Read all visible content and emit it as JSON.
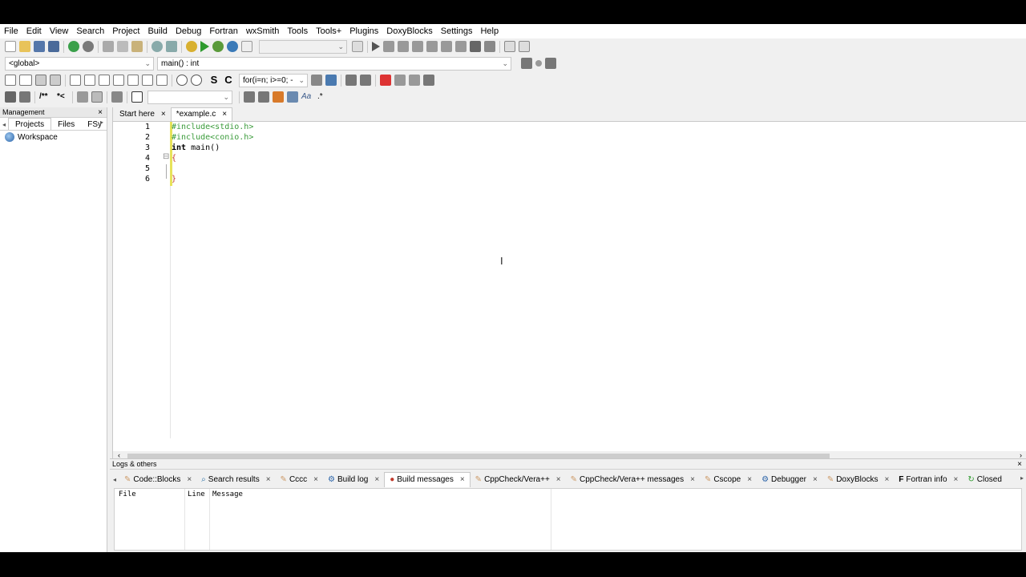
{
  "menu": [
    "File",
    "Edit",
    "View",
    "Search",
    "Project",
    "Build",
    "Debug",
    "Fortran",
    "wxSmith",
    "Tools",
    "Tools+",
    "Plugins",
    "DoxyBlocks",
    "Settings",
    "Help"
  ],
  "scope_combo": "<global>",
  "function_combo": "main() : int",
  "search_combo": "for(i=n; i>=0; -",
  "management": {
    "title": "Management",
    "close": "×",
    "tabs": [
      "Projects",
      "Files",
      "FSy"
    ],
    "workspace": "Workspace"
  },
  "editor": {
    "tabs": [
      {
        "label": "Start here",
        "close": "×"
      },
      {
        "label": "*example.c",
        "close": "×"
      }
    ],
    "line_numbers": [
      "1",
      "2",
      "3",
      "4",
      "5",
      "6"
    ],
    "lines": [
      "#include<stdio.h>",
      "#include<conio.h>",
      "main()",
      "{",
      "",
      "}"
    ],
    "keyword": "int",
    "fold_icon": "⊟"
  },
  "logs": {
    "title": "Logs & others",
    "close": "×",
    "tabs": [
      "Code::Blocks",
      "Search results",
      "Cccc",
      "Build log",
      "Build messages",
      "CppCheck/Vera++",
      "CppCheck/Vera++ messages",
      "Cscope",
      "Debugger",
      "DoxyBlocks",
      "Fortran info",
      "Closed"
    ],
    "active_tab": "Build messages",
    "columns": [
      "File",
      "Line",
      "Message"
    ]
  },
  "colors": {
    "preprocessor": "#3a9b3a",
    "brace": "#c0392b",
    "keyword": "#000080",
    "change_bar": "#e7e35a"
  },
  "icons": [
    "new-file-icon",
    "open-icon",
    "save-icon",
    "save-all-icon",
    "undo-icon",
    "redo-icon",
    "cut-icon",
    "copy-icon",
    "paste-icon",
    "find-icon",
    "replace-icon",
    "build-icon",
    "run-icon",
    "build-run-icon",
    "rebuild-icon",
    "abort-icon"
  ]
}
